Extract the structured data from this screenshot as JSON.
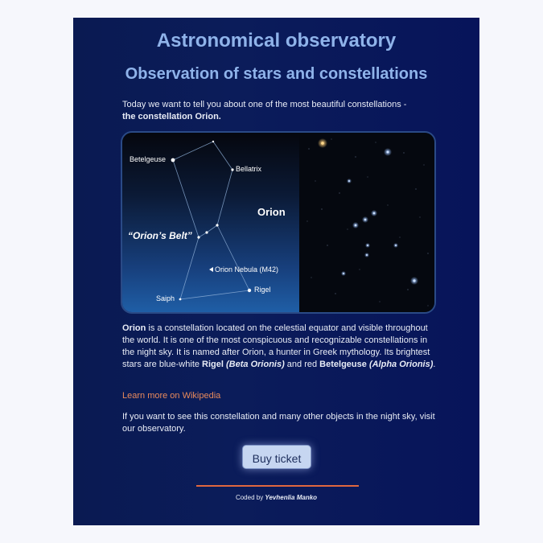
{
  "header": {
    "title": "Astronomical observatory",
    "subtitle": "Observation of stars and constellations"
  },
  "intro": {
    "text": "Today we want to tell you about one of the most beautiful constellations -",
    "bold": "the constellation Orion."
  },
  "figure": {
    "labels": {
      "betelgeuse": "Betelgeuse",
      "bellatrix": "Bellatrix",
      "orion": "Orion",
      "belt": "“Orion’s Belt”",
      "nebula": "Orion Nebula (M42)",
      "rigel": "Rigel",
      "saiph": "Saiph"
    }
  },
  "description": {
    "orion": "Orion",
    "p1": " is a constellation located on the celestial equator and visible throughout the world. It is one of the most conspicuous and recognizable constellations in the night sky. It is named after Orion, a hunter in Greek mythology. Its brightest stars are blue-white ",
    "rigel": "Rigel",
    "rigel_alt": "(Beta Orionis)",
    "p2": " and red ",
    "betelgeuse": "Betelgeuse",
    "betelgeuse_alt": "(Alpha Orionis)",
    "end": "."
  },
  "link": {
    "text": "Learn more on Wikipedia"
  },
  "visit": {
    "text": "If you want to see this constellation and many other objects in the night sky, visit our observatory."
  },
  "button": {
    "label": "Buy ticket"
  },
  "footer": {
    "coded_by": "Coded by ",
    "author": "Yevhenlia Manko"
  },
  "colors": {
    "heading": "#8fb3ea",
    "link": "#e98a5b",
    "rule": "#e0673f",
    "button_bg": "#c6d6f1"
  }
}
